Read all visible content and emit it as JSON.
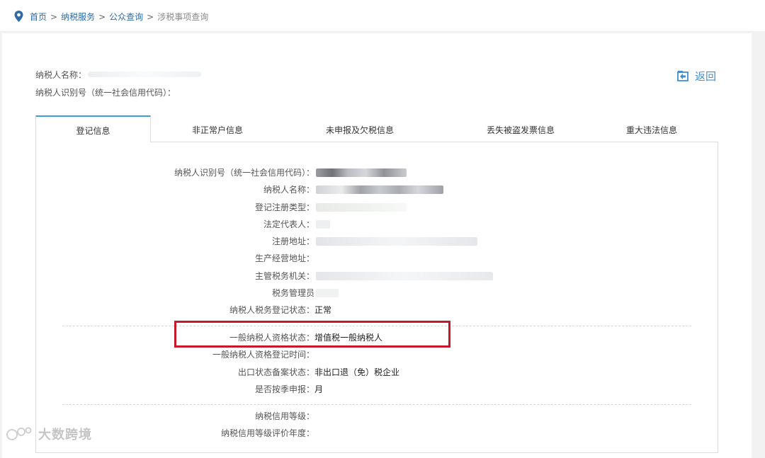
{
  "breadcrumb": {
    "items": [
      "首页",
      "纳税服务",
      "公众查询"
    ],
    "separator": ">",
    "current": "涉税事项查询"
  },
  "header": {
    "taxpayer_name_label": "纳税人名称：",
    "taxpayer_id_label": "纳税人识别号（统一社会信用代码）："
  },
  "back": {
    "label": "返回"
  },
  "tabs": [
    {
      "label": "登记信息",
      "active": true
    },
    {
      "label": "非正常户信息",
      "active": false
    },
    {
      "label": "未申报及欠税信息",
      "active": false
    },
    {
      "label": "丢失被盗发票信息",
      "active": false
    },
    {
      "label": "重大违法信息",
      "active": false
    }
  ],
  "fields": [
    {
      "label": "纳税人识别号（统一社会信用代码）：",
      "value": ""
    },
    {
      "label": "纳税人名称：",
      "value": ""
    },
    {
      "label": "登记注册类型：",
      "value": ""
    },
    {
      "label": "法定代表人：",
      "value": ""
    },
    {
      "label": "注册地址：",
      "value": ""
    },
    {
      "label": "生产经营地址：",
      "value": ""
    },
    {
      "label": "主管税务机关：",
      "value": ""
    },
    {
      "label": "税务管理员",
      "value": ""
    },
    {
      "label": "纳税人税务登记状态：",
      "value": "正常"
    }
  ],
  "fields2": [
    {
      "label": "一般纳税人资格状态：",
      "value": "增值税一般纳税人"
    },
    {
      "label": "一般纳税人资格登记时间：",
      "value": ""
    },
    {
      "label": "出口状态备案状态：",
      "value": "非出口退（免）税企业"
    },
    {
      "label": "是否按季申报：",
      "value": "月"
    }
  ],
  "fields3": [
    {
      "label": "纳税信用等级：",
      "value": ""
    },
    {
      "label": "纳税信用等级评价年度：",
      "value": ""
    }
  ],
  "watermark": {
    "text": "大数跨境"
  },
  "colors": {
    "link": "#2d6aa8",
    "accent": "#3aa0d9",
    "back": "#3f8fd1",
    "highlight_box": "#c8172b"
  },
  "icons": {
    "location": "location-pin-icon",
    "back": "return-arrow-icon"
  }
}
